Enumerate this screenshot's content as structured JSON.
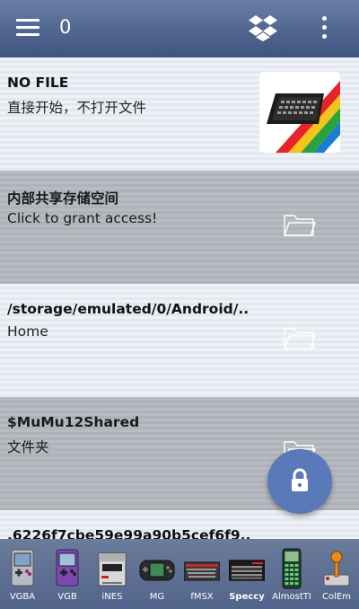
{
  "topbar": {
    "counter": "0"
  },
  "icons": {
    "menu": "hamburger-menu-icon",
    "cloud": "dropbox-icon",
    "overflow": "more-vertical-icon",
    "folder": "folder-icon",
    "fab": "lock-icon"
  },
  "files": [
    {
      "title": "NO FILE",
      "subtitle": "直接开始，不打开文件",
      "style": "light",
      "icon": "zx-spectrum-thumbnail"
    },
    {
      "title": "内部共享存储空间",
      "subtitle": "Click to grant access!",
      "style": "gray",
      "icon": "folder-icon"
    },
    {
      "title": "/storage/emulated/0/Android/..",
      "subtitle": "Home",
      "style": "light",
      "icon": "folder-icon"
    },
    {
      "title": "$MuMu12Shared",
      "subtitle": "文件夹",
      "style": "gray",
      "icon": "folder-icon"
    },
    {
      "title": ".6226f7cbe59e99a90b5cef6f9..",
      "subtitle": "",
      "style": "light",
      "icon": "folder-icon"
    }
  ],
  "emulators": [
    {
      "label": "VGBA",
      "icon": "gameboy-advance-icon",
      "active": false
    },
    {
      "label": "VGB",
      "icon": "gameboy-color-icon",
      "active": false
    },
    {
      "label": "iNES",
      "icon": "nes-console-icon",
      "active": false
    },
    {
      "label": "MG",
      "icon": "game-gear-icon",
      "active": false
    },
    {
      "label": "fMSX",
      "icon": "msx-computer-icon",
      "active": false
    },
    {
      "label": "Speccy",
      "icon": "zx-spectrum-icon",
      "active": true
    },
    {
      "label": "AlmostTI",
      "icon": "ti-calculator-icon",
      "active": false
    },
    {
      "label": "ColEm",
      "icon": "coleco-joystick-icon",
      "active": false
    }
  ],
  "colors": {
    "topbar": "#50668f",
    "fab": "#5a79b8",
    "row_light": "#eef1f6",
    "row_gray": "#b8bcc2",
    "bottombar": "#5d6f93"
  }
}
